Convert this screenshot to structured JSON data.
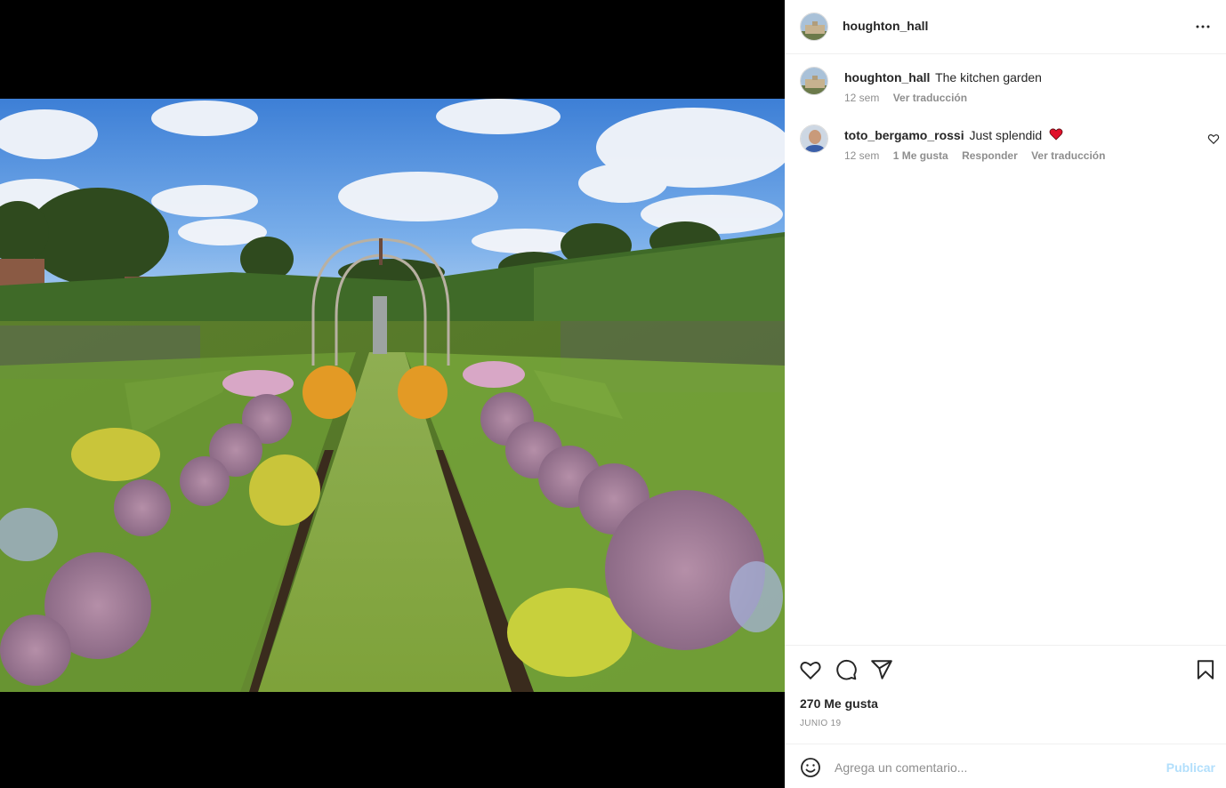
{
  "post": {
    "username": "houghton_hall",
    "photo_alt": "Garden path with arched trellis, allium flowers and hedges under a blue cloudy sky"
  },
  "caption": {
    "username": "houghton_hall",
    "text": "The kitchen garden",
    "time": "12 sem",
    "translate": "Ver traducción"
  },
  "comments": [
    {
      "username": "toto_bergamo_rossi",
      "text": "Just splendid",
      "emoji": "red-heart",
      "time": "12 sem",
      "likes": "1 Me gusta",
      "reply": "Responder",
      "translate": "Ver traducción"
    }
  ],
  "actions": {
    "likes_count": "270 Me gusta",
    "date": "JUNIO 19"
  },
  "add_comment": {
    "placeholder": "Agrega un comentario...",
    "publish": "Publicar"
  },
  "colors": {
    "text": "#262626",
    "secondary": "#8e8e8e",
    "publish_disabled": "#b2dffc",
    "heart": "#ed4956"
  },
  "icons": [
    "more-icon",
    "like-icon",
    "comment-icon",
    "share-icon",
    "save-icon",
    "emoji-icon",
    "small-like-icon"
  ]
}
